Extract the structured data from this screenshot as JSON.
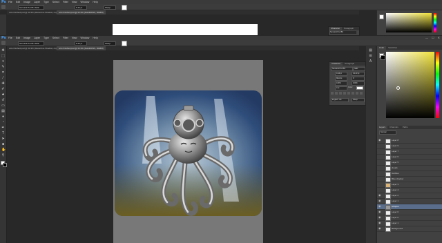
{
  "app": {
    "logo": "Ps"
  },
  "menu": [
    "File",
    "Edit",
    "Image",
    "Layer",
    "Type",
    "Select",
    "Filter",
    "View",
    "Window",
    "Help"
  ],
  "window_controls": [
    "—",
    "☐",
    "✕"
  ],
  "options_bar": {
    "font_family": "Sensical Pod B1 Italic",
    "font_size": "9.44 pt",
    "leading": "Sharp"
  },
  "documents": {
    "back_tab": "octo finished.psd @ 33.3% (Diesel line Shadow, copy/octopus, RGB/8)",
    "back_tab_2": "octo finished.psd @ 33.3% (SHADOWS, RGB/8)",
    "front_tab": "octo finished.psd @ 33.3% (Diesel line Shadow, copy/octopus, RGB/8)",
    "front_tab_2": "octo finished.psd @ 33.3% (SHADOWS, RGB/8)"
  },
  "right_panels": {
    "tabs_top": [
      "Color",
      "Swatches"
    ],
    "tabs_mini": [
      "Character",
      "Paragraph"
    ],
    "tabs_layers": [
      "Layers",
      "Channels",
      "Paths"
    ],
    "layer_mode": "Normal",
    "layers": [
      "Layer 8",
      "Layer 9",
      "Layer 7",
      "Layer 6",
      "Layer 5",
      "clouds",
      "bubbles",
      "Blue shadow",
      "Layer 3",
      "Layer 4",
      "Layer 2",
      "Layer 1",
      "octopus",
      "Layer 6",
      "Layer 0",
      "Layer 1",
      "Background"
    ],
    "selected_layer": "octopus"
  },
  "character_panel": {
    "title_tabs": [
      "Character",
      "Paragraph"
    ],
    "font": "Sensical Pod B1",
    "style": "Italic",
    "size": "9.44 pt",
    "leading": "13.23 pt",
    "kerning": "Metrics",
    "tracking": "0",
    "scale_v": "100%",
    "scale_h": "100%",
    "baseline": "0 pt",
    "color_label": "Color:",
    "language": "English: UK",
    "aa": "Sharp"
  },
  "colors": {
    "foreground": "#ffffff",
    "background": "#000000",
    "picker_hue": "#f0e23a",
    "selected_layer": "#5a6e8c"
  }
}
